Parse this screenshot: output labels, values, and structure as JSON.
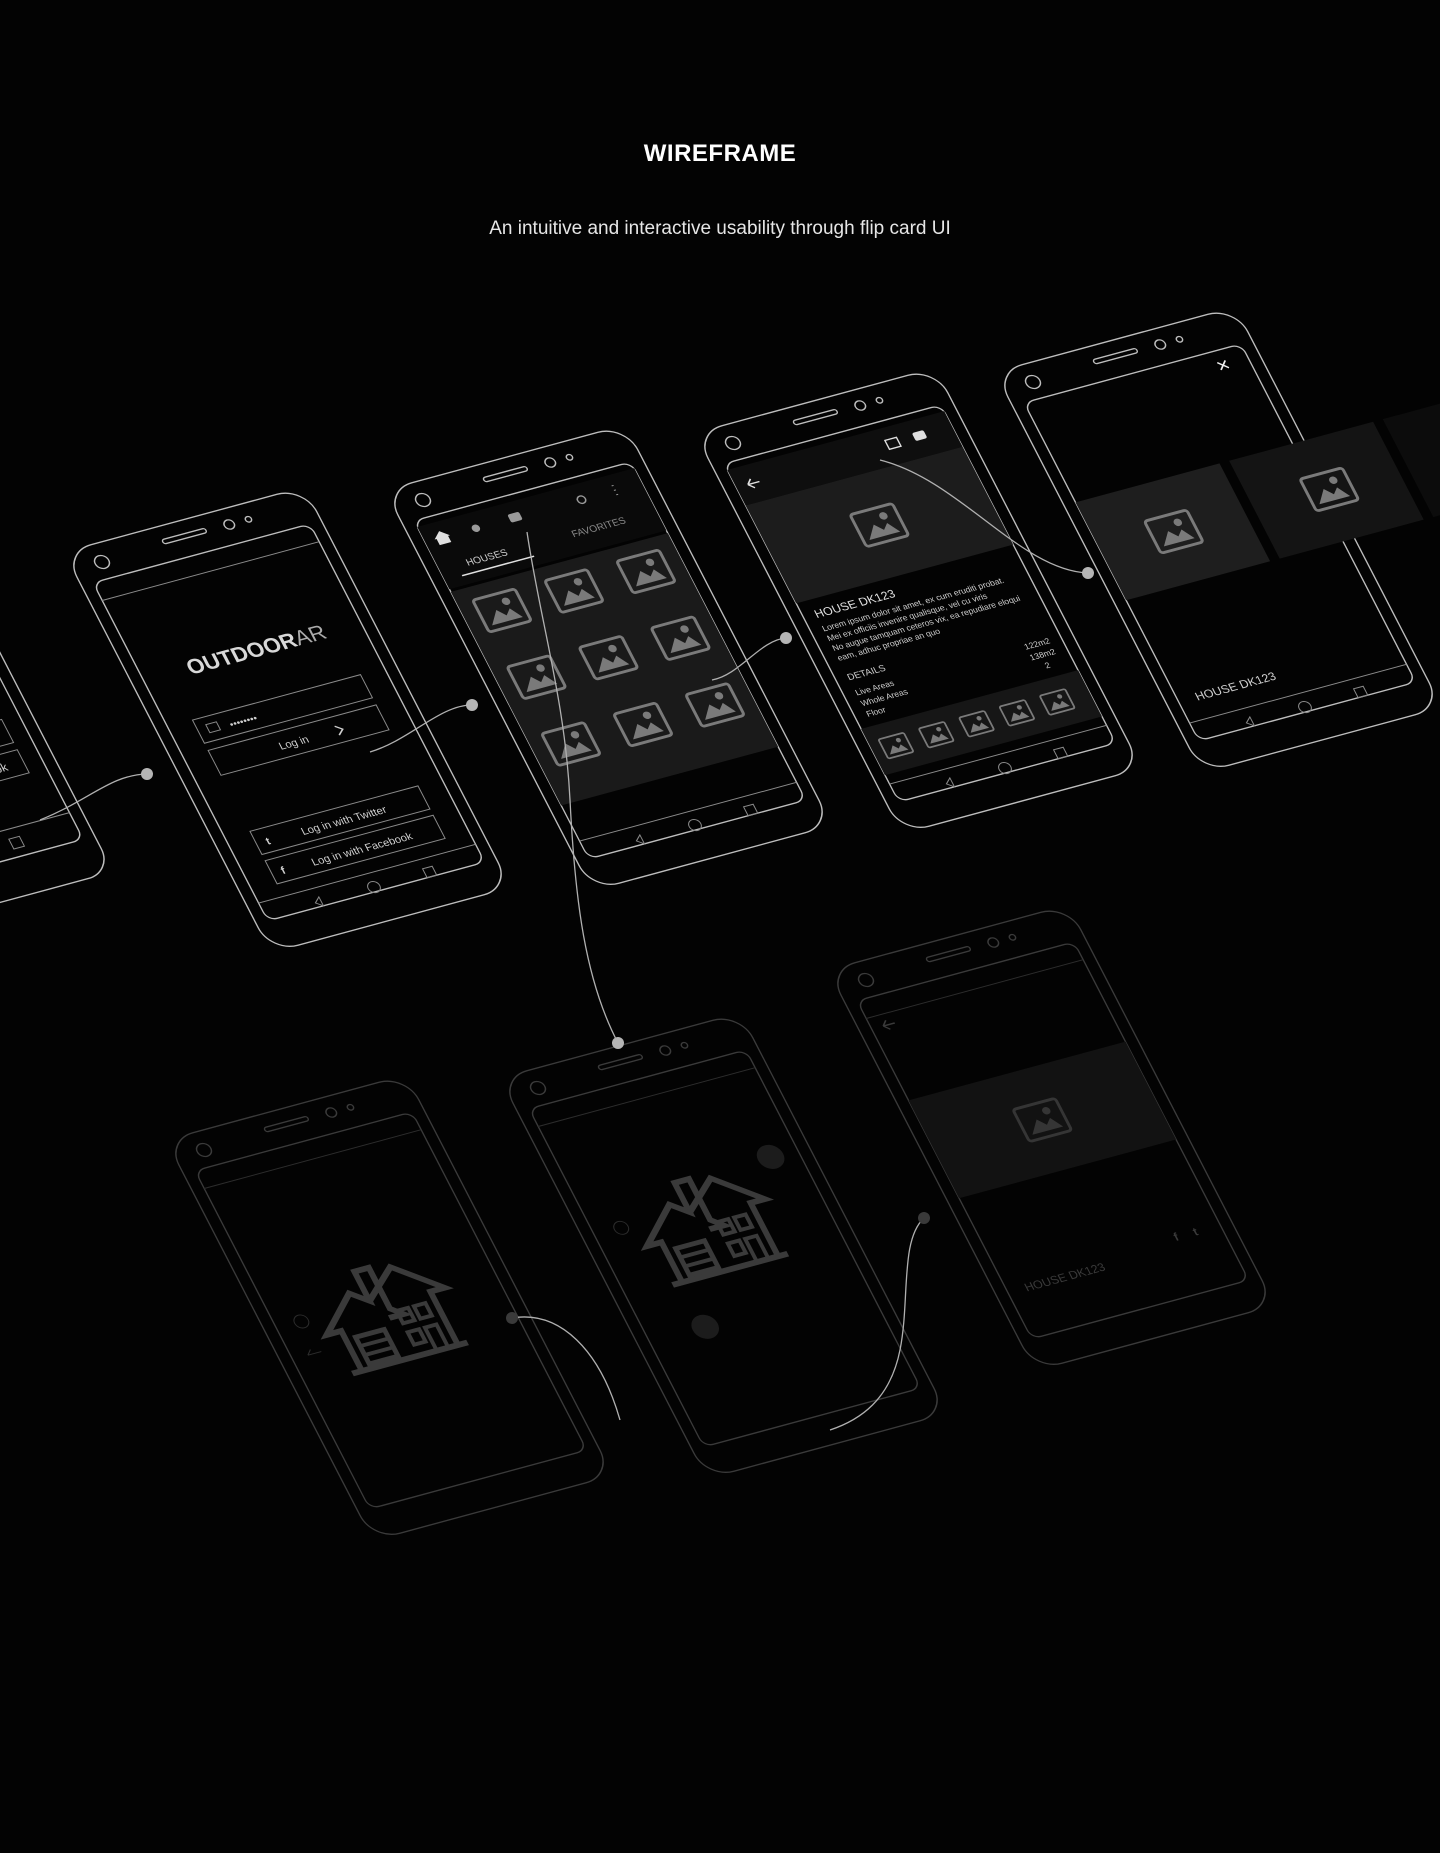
{
  "header": {
    "title": "WIREFRAME",
    "subtitle": "An intuitive and interactive usability through flip card UI"
  },
  "login": {
    "logo_bold": "OUTDOOR",
    "logo_light": "AR",
    "password_mask": "••••••••",
    "login_label": "Log in",
    "twitter_label": "Log in with Twitter",
    "facebook_label": "Log in with Facebook",
    "partial_twitter": "witter",
    "partial_facebook": "h Facebook"
  },
  "listing": {
    "tab_houses": "HOUSES",
    "tab_favorites": "FAVORITES"
  },
  "detail": {
    "house_title": "HOUSE DK123",
    "lorem_1": "Lorem ipsum dolor sit amet, ex cum eruditi probat.",
    "lorem_2": "Mei ex officiis invenire qualisque, vel cu viris",
    "lorem_3": "No augue tamquam ceteros vix, ea repudiare eloqui",
    "lorem_4": "eam, adhuc propriae an quo",
    "details_label": "DETAILS",
    "row1_label": "Live Areas",
    "row1_value": "122m2",
    "row2_label": "Whole Areas",
    "row2_value": "138m2",
    "row3_label": "Floor",
    "row3_value": "2"
  },
  "viewer": {
    "house_title": "HOUSE DK123",
    "close_glyph": "✕"
  },
  "ar_view": {
    "house_title": "HOUSE DK123"
  }
}
